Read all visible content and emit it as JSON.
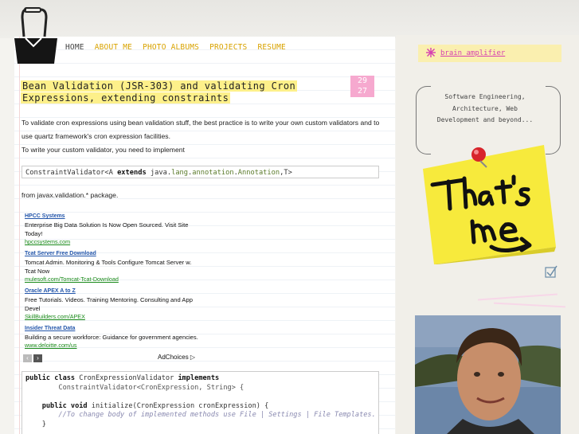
{
  "nav": {
    "items": [
      {
        "label": "HOME"
      },
      {
        "label": "ABOUT ME"
      },
      {
        "label": "PHOTO ALBUMS"
      },
      {
        "label": "PROJECTS"
      },
      {
        "label": "RESUME"
      }
    ]
  },
  "post": {
    "title": "Bean Validation (JSR-303) and validating Cron Expressions, extending constraints",
    "date": {
      "line1": "29",
      "line2": "27"
    },
    "para1": "To validate cron expressions using bean validation stuff, the best practice is to write your own custom validators and to",
    "para2": "use quartz framework's cron expression facilities.",
    "para3": "To write your custom validator, you need to implement",
    "code_inline": {
      "t1": "ConstraintValidator<A ",
      "kw": "extends",
      "t2": " java.",
      "p1": "lang",
      "t3": ".",
      "p2": "annotation",
      "t4": ".",
      "p3": "Annotation",
      "t5": ",T>"
    },
    "para4": "from javax.validation.* package."
  },
  "ads": {
    "items": [
      {
        "title": "HPCC Systems",
        "desc": "Enterprise Big Data Solution Is Now Open Sourced. Visit Site Today!",
        "url": "hpccsystems.com"
      },
      {
        "title": "Tcat Server Free Download",
        "desc": "Tomcat Admin. Monitoring & Tools Configure Tomcat Server w. Tcat Now",
        "url": "mulesoft.com/Tomcat-Tcat-Download"
      },
      {
        "title": "Oracle APEX A to Z",
        "desc": "Free Tutorials. Videos. Training Mentoring. Consulting and App Devel",
        "url": "SkillBuilders.com/APEX"
      },
      {
        "title": "Insider Threat Data",
        "desc": "Building a secure workforce: Guidance for government agencies.",
        "url": "www.deloitte.com/us"
      }
    ],
    "adchoices": "AdChoices",
    "prev": "‹",
    "next": "›"
  },
  "code_block": {
    "l1_kw1": "public class",
    "l1_name": " CronExpressionValidator ",
    "l1_kw2": "implements",
    "l2": "        ConstraintValidator<CronExpression, String> {",
    "l3_kw": "    public void",
    "l3_rest": " initialize(CronExpression cronExpression) {",
    "l4": "        //To change body of implemented methods use File | Settings | File Templates.",
    "l5": "    }"
  },
  "sidebar": {
    "brain_title": "brain amplifier",
    "tagline": "Software Engineering, Architecture, Web Development and beyond..."
  },
  "colors": {
    "accent": "#d9a300",
    "highlight": "#fdf08a",
    "pink": "#f6a9cf",
    "postit": "#f7ea3c"
  }
}
